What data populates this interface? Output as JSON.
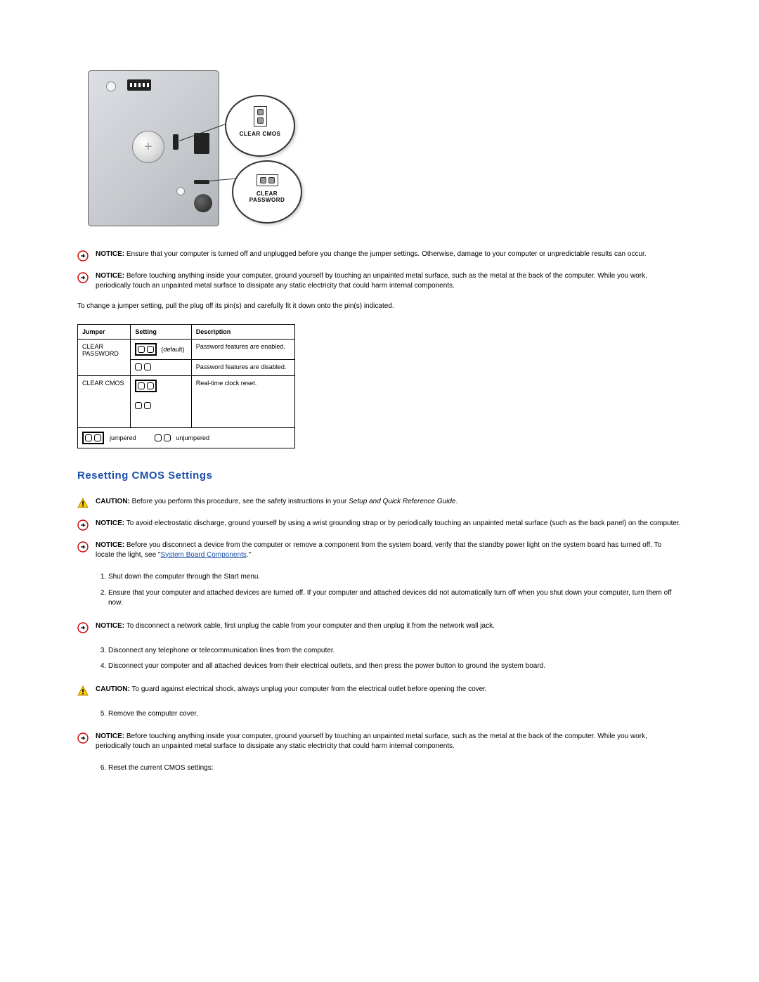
{
  "diagram": {
    "callout1": "CLEAR CMOS",
    "callout2_line1": "CLEAR",
    "callout2_line2": "PASSWORD"
  },
  "notices": {
    "n1_label": "NOTICE:",
    "n1_text": " Ensure that your computer is turned off and unplugged before you change the jumper settings. Otherwise, damage to your computer or unpredictable results can occur.",
    "n2_label": "NOTICE:",
    "n2_text": " Before touching anything inside your computer, ground yourself by touching an unpainted metal surface, such as the metal at the back of the computer. While you work, periodically touch an unpainted metal surface to dissipate any static electricity that could harm internal components."
  },
  "intro_para": "To change a jumper setting, pull the plug off its pin(s) and carefully fit it down onto the pin(s) indicated.",
  "table": {
    "headers": {
      "jumper": "Jumper",
      "setting": "Setting",
      "description": "Description"
    },
    "r1_jumper_line1": "CLEAR",
    "r1_jumper_line2": "PASSWORD",
    "r1_default": "(default)",
    "r1_desc": "Password features are enabled.",
    "r2_desc": "Password features are disabled.",
    "r3_jumper": "CLEAR CMOS",
    "r3_desc": "Real-time clock reset.",
    "legend_jumpered": "jumpered",
    "legend_unjumpered": "unjumpered"
  },
  "heading": "Resetting CMOS Settings",
  "caution1_label": "CAUTION:",
  "caution1_text_a": " Before you perform this procedure, see the safety instructions in your ",
  "caution1_text_b": "Setup and Quick Reference Guide",
  "caution1_text_c": ".",
  "notice3_label": "NOTICE:",
  "notice3_text": " To avoid electrostatic discharge, ground yourself by using a wrist grounding strap or by periodically touching an unpainted metal surface (such as the back panel) on the computer.",
  "notice4_label": "NOTICE:",
  "notice4_text_a": " Before you disconnect a device from the computer or remove a component from the system board, verify that the standby power light on the system board has turned off. To locate the light, see \"",
  "notice4_link": "System Board Components",
  "notice4_text_b": ".\"",
  "steps_a": {
    "1": "Shut down the computer through the Start menu.",
    "2": "Ensure that your computer and attached devices are turned off. If your computer and attached devices did not automatically turn off when you shut down your computer, turn them off now."
  },
  "notice5_label": "NOTICE:",
  "notice5_text": " To disconnect a network cable, first unplug the cable from your computer and then unplug it from the network wall jack.",
  "steps_b": {
    "3": "Disconnect any telephone or telecommunication lines from the computer.",
    "4": "Disconnect your computer and all attached devices from their electrical outlets, and then press the power button to ground the system board."
  },
  "caution2_label": "CAUTION:",
  "caution2_text": " To guard against electrical shock, always unplug your computer from the electrical outlet before opening the cover.",
  "steps_c": {
    "5": "Remove the computer cover."
  },
  "notice6_label": "NOTICE:",
  "notice6_text": " Before touching anything inside your computer, ground yourself by touching an unpainted metal surface, such as the metal at the back of the computer. While you work, periodically touch an unpainted metal surface to dissipate any static electricity that could harm internal components.",
  "steps_d": {
    "6": "Reset the current CMOS settings:"
  }
}
